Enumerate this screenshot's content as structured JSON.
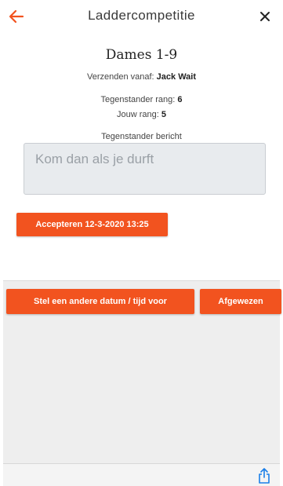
{
  "header": {
    "title": "Laddercompetitie",
    "back_icon": "arrow-left-icon",
    "close_icon": "close-icon",
    "close_glyph": "×"
  },
  "challenge": {
    "match_title": "Dames 1-9",
    "sender_label": "Verzenden vanaf:",
    "sender_name": "Jack Wait",
    "opponent_rank_label": "Tegenstander rang:",
    "opponent_rank": "6",
    "own_rank_label": "Jouw rang:",
    "own_rank": "5",
    "message_label": "Tegenstander bericht",
    "message": "Kom dan als je durft"
  },
  "actions": {
    "accept_label": "Accepteren 12-3-2020 13:25",
    "other_time_label": "Stel een andere datum / tijd voor",
    "reject_label": "Afgewezen"
  },
  "toolbar": {
    "share_icon": "share-icon"
  },
  "colors": {
    "accent": "#f2531f",
    "message_box": "#e8ebee",
    "panel": "#eeeeee"
  }
}
